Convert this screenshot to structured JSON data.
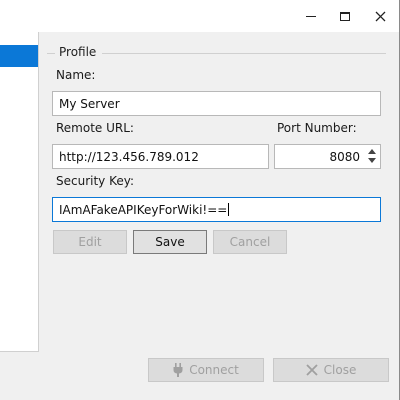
{
  "window": {
    "minimize_icon": "minimize-icon",
    "maximize_icon": "maximize-icon",
    "close_icon": "close-icon"
  },
  "profile": {
    "group_title": "Profile",
    "name_label": "Name:",
    "name_value": "My Server",
    "url_label": "Remote URL:",
    "url_value": "http://123.456.789.012",
    "port_label": "Port Number:",
    "port_value": "8080",
    "key_label": "Security Key:",
    "key_value": "IAmAFakeAPIKeyForWiki!=="
  },
  "buttons": {
    "edit": "Edit",
    "save": "Save",
    "cancel": "Cancel",
    "connect": "Connect",
    "close": "Close"
  },
  "colors": {
    "accent": "#0b78d7",
    "disabled_text": "#a0a0a0"
  }
}
